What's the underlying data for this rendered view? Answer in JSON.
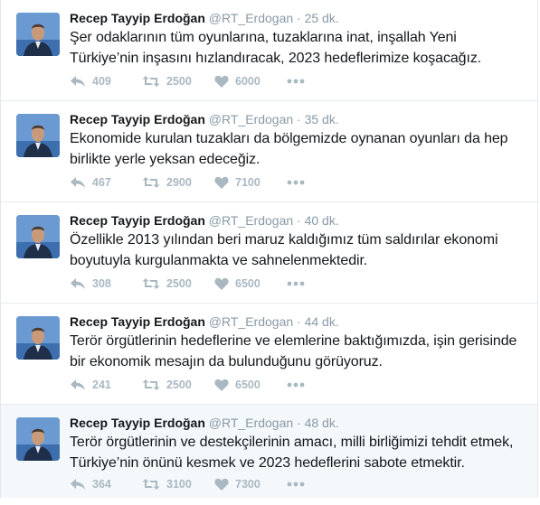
{
  "colors": {
    "name": "#14171a",
    "secondary": "#8899a6",
    "action_icon": "#aab8c2",
    "highlight_bg": "#f5f8fa"
  },
  "icons": {
    "reply": "reply-arrow-icon",
    "retweet": "retweet-icon",
    "like": "heart-icon",
    "more": "more-dots-icon"
  },
  "tweets": [
    {
      "fullname": "Recep Tayyip Erdoğan",
      "username": "@RT_Erdogan",
      "separator": "·",
      "time": "25 dk.",
      "text_line1": "Şer odaklarının tüm oyunlarına, tuzaklarına inat, inşallah Yeni",
      "text_line2": "Türkiye’nin inşasını hızlandıracak, 2023 hedeflerimize koşacağız.",
      "replies": "409",
      "retweets": "2500",
      "likes": "6000"
    },
    {
      "fullname": "Recep Tayyip Erdoğan",
      "username": "@RT_Erdogan",
      "separator": "·",
      "time": "35 dk.",
      "text_line1": "Ekonomide kurulan tuzakları da bölgemizde oynanan oyunları da hep",
      "text_line2": "birlikte yerle yeksan edeceğiz.",
      "replies": "467",
      "retweets": "2900",
      "likes": "7100"
    },
    {
      "fullname": "Recep Tayyip Erdoğan",
      "username": "@RT_Erdogan",
      "separator": "·",
      "time": "40 dk.",
      "text_line1": "Özellikle 2013 yılından beri maruz kaldığımız tüm saldırılar ekonomi",
      "text_line2": "boyutuyla kurgulanmakta ve sahnelenmektedir.",
      "replies": "308",
      "retweets": "2500",
      "likes": "6500"
    },
    {
      "fullname": "Recep Tayyip Erdoğan",
      "username": "@RT_Erdogan",
      "separator": "·",
      "time": "44 dk.",
      "text_line1": "Terör örgütlerinin hedeflerine ve elemlerine baktığımızda, işin gerisinde",
      "text_line2": "bir ekonomik mesajın da bulunduğunu görüyoruz.",
      "replies": "241",
      "retweets": "2500",
      "likes": "6500"
    },
    {
      "fullname": "Recep Tayyip Erdoğan",
      "username": "@RT_Erdogan",
      "separator": "·",
      "time": "48 dk.",
      "text_line1": "Terör örgütlerinin ve destekçilerinin amacı, milli birliğimizi tehdit etmek,",
      "text_line2": "Türkiye’nin önünü kesmek ve 2023 hedeflerini sabote etmektir.",
      "replies": "364",
      "retweets": "3100",
      "likes": "7300"
    }
  ]
}
